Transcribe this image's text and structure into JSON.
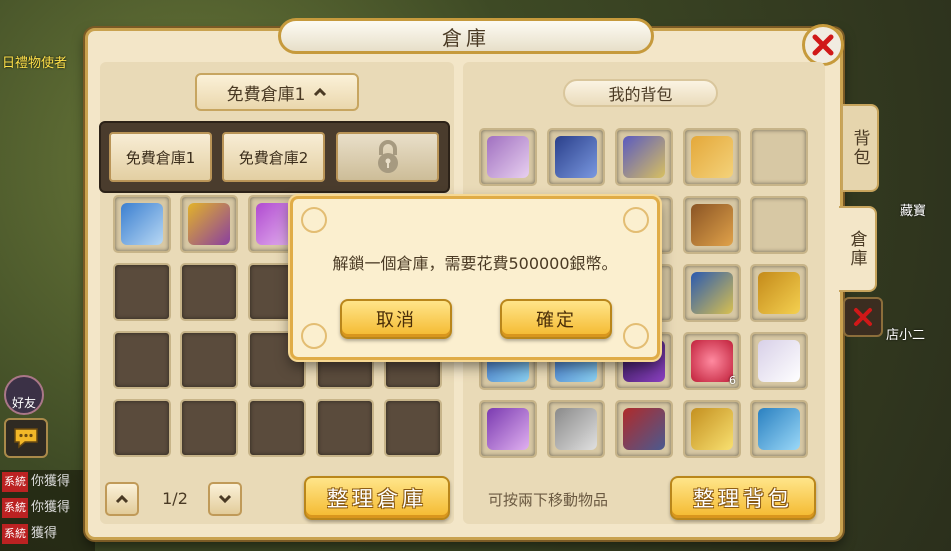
{
  "background": {
    "npc_label": "日禮物使者",
    "friend_label": "好友",
    "chat_lines": [
      {
        "tag": "系統",
        "text": "你獲得"
      },
      {
        "tag": "系統",
        "text": "你獲得"
      },
      {
        "tag": "系統",
        "text": "獲得"
      }
    ],
    "right_labels": [
      "藏寶",
      "店小二"
    ]
  },
  "window": {
    "title": "倉庫",
    "close_icon": "close-x-icon"
  },
  "storage": {
    "dropdown_label": "免費倉庫1",
    "dropdown_options": [
      "免費倉庫1",
      "免費倉庫2"
    ],
    "locked_option_icon": "lock-icon",
    "page_indicator": "1/2",
    "sort_button": "整理倉庫",
    "items": [
      "sword-icon",
      "yellow-robe-icon",
      "purple-belt-icon"
    ]
  },
  "bag": {
    "title": "我的背包",
    "hint": "可按兩下移動物品",
    "sort_button": "整理背包",
    "items": [
      "purple-pouch-icon",
      "blue-armor-icon",
      "silver-bracelet-icon",
      "straw-hat-icon",
      "",
      "",
      "",
      "",
      "leather-boots-icon",
      "",
      "",
      "",
      "",
      "blue-sword-icon",
      "gold-armor-icon",
      "blue-gauntlet-icon",
      "blue-gauntlet-icon",
      "dark-orb-icon",
      "red-orb-icon",
      "white-sash-icon",
      "purple-necklace-icon",
      "steel-sword-icon",
      "red-armor-icon",
      "gold-ring-icon",
      "blue-boots-icon"
    ],
    "red_orb_count": "6"
  },
  "side_tabs": {
    "bag_tab": "背包",
    "storage_tab": "倉庫"
  },
  "dialog": {
    "message": "解鎖一個倉庫，需要花費500000銀幣。",
    "cancel_button": "取消",
    "confirm_button": "確定"
  },
  "colors": {
    "panel_bg": "#f3e6c8",
    "gold_button": "#f4b92e",
    "slot_dark": "#5a4b3c",
    "close_red": "#d01818"
  }
}
